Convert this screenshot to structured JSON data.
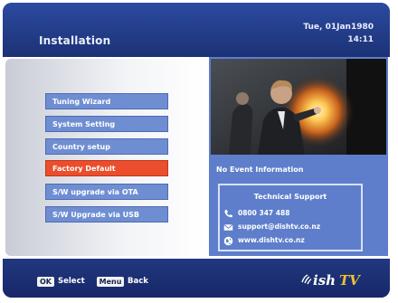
{
  "header": {
    "title": "Installation",
    "date": "Tue, 01Jan1980",
    "time": "14:11"
  },
  "menu": {
    "items": [
      {
        "label": "Tuning Wizard",
        "selected": false
      },
      {
        "label": "System Setting",
        "selected": false
      },
      {
        "label": "Country setup",
        "selected": false
      },
      {
        "label": "Factory Default",
        "selected": true
      },
      {
        "label": "S/W upgrade via OTA",
        "selected": false
      },
      {
        "label": "S/W Upgrade via USB",
        "selected": false
      }
    ]
  },
  "event": {
    "info": "No Event Information"
  },
  "support": {
    "title": "Technical Support",
    "phone": "0800 347 488",
    "email": "support@dishtv.co.nz",
    "web": "www.dishtv.co.nz"
  },
  "footer": {
    "ok_key": "OK",
    "ok_label": "Select",
    "menu_key": "Menu",
    "menu_label": "Back",
    "logo_text": "DishTV"
  },
  "colors": {
    "header": "#2c4aa0",
    "menu_item": "#6f8ed2",
    "selected_item": "#ea4e2c",
    "info_panel": "#5e7ecb",
    "footer": "#1c3275"
  },
  "icons": {
    "phone": "phone-icon",
    "email": "envelope-icon",
    "web": "globe-icon"
  }
}
